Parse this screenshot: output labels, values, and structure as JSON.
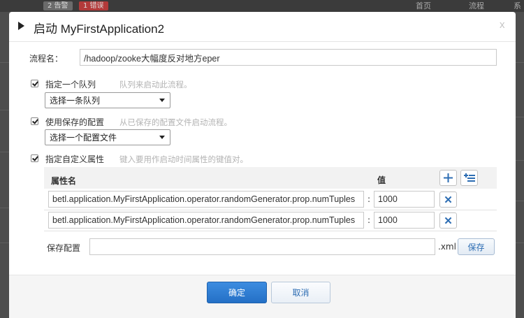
{
  "background": {
    "badge_warn": "2 告警",
    "badge_error": "1 错误",
    "nav_home": "首页",
    "nav_flow": "流程",
    "nav_more": "系"
  },
  "dialog": {
    "title": "启动 MyFirstApplication2",
    "close": "x",
    "flow_name_label": "流程名：",
    "flow_name_value": "/hadoop/zooke大幅度反对地方eper",
    "queue": {
      "checked": true,
      "label": "指定一个队列",
      "hint": "队列来启动此流程。",
      "select_value": "选择一条队列"
    },
    "saved_config": {
      "checked": true,
      "label": "使用保存的配置",
      "hint": "从已保存的配置文件启动流程。",
      "select_value": "选择一个配置文件"
    },
    "custom_props": {
      "checked": true,
      "label": "指定自定义属性",
      "hint": "键入要用作启动时间属性的键值对。",
      "col_name": "属性名",
      "col_value": "值",
      "rows": [
        {
          "name": "betl.application.MyFirstApplication.operator.randomGenerator.prop.numTuples",
          "value": "1000"
        },
        {
          "name": "betl.application.MyFirstApplication.operator.randomGenerator.prop.numTuples",
          "value": "1000"
        }
      ],
      "separator": ":",
      "remove_glyph": "✕"
    },
    "save_config_label": "保存配置",
    "save_config_ext": ".xml",
    "save_button": "保存",
    "ok_button": "确定",
    "cancel_button": "取消"
  },
  "colors": {
    "accent": "#2470c6",
    "link": "#2d6db3",
    "badge_error": "#b33a3a"
  }
}
